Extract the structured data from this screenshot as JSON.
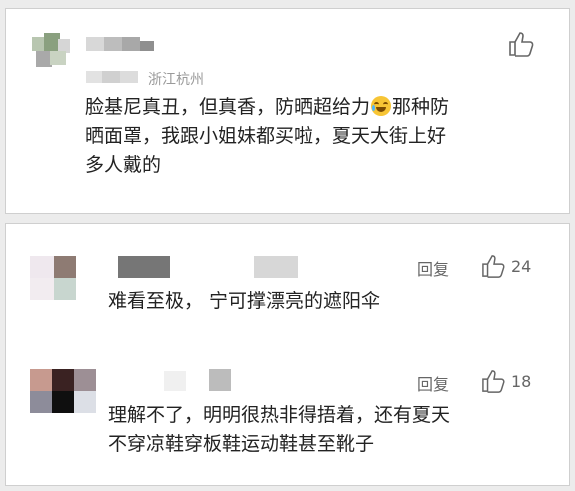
{
  "main_comment": {
    "location": "浙江杭州",
    "text_line1": "脸基尼真丑，但真香，防晒超给力",
    "text_line1_tail": "那种防",
    "text_line2": "晒面罩，我跟小姐妹都买啦，夏天大街上好",
    "text_line3": "多人戴的",
    "emoji_icon": "laugh-tears-emoji"
  },
  "replies": [
    {
      "text": "难看至极，  宁可撑漂亮的遮阳伞",
      "reply_label": "回复",
      "like_count": "24"
    },
    {
      "text_line1": "理解不了，明明很热非得捂着，还有夏天",
      "text_line2": "不穿凉鞋穿板鞋运动鞋甚至靴子",
      "reply_label": "回复",
      "like_count": "18"
    }
  ],
  "colors": {
    "background": "#ececec",
    "card": "#ffffff",
    "text": "#222222",
    "muted": "#9a9a9a"
  }
}
